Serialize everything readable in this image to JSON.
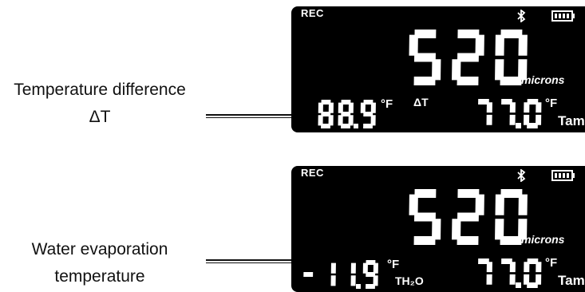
{
  "callouts": {
    "delta": {
      "line1": "Temperature difference",
      "line2": "ΔT"
    },
    "evap": {
      "line1": "Water evaporation",
      "line2": "temperature"
    }
  },
  "displays": [
    {
      "rec": "REC",
      "main_value": "520",
      "main_unit": "microns",
      "left_value": "88.9",
      "left_unit": "°F",
      "left_label": "ΔT",
      "right_value": "77.0",
      "right_unit": "°F",
      "right_label": "Tamb"
    },
    {
      "rec": "REC",
      "main_value": "520",
      "main_unit": "microns",
      "left_value": "-11.9",
      "left_unit": "°F",
      "left_label": "TH₂O",
      "right_value": "77.0",
      "right_unit": "°F",
      "right_label": "Tamb"
    }
  ],
  "colors": {
    "panel": "#000000",
    "segments": "#ffffff",
    "text": "#111111"
  },
  "icons": [
    "bluetooth-icon",
    "battery-icon"
  ]
}
